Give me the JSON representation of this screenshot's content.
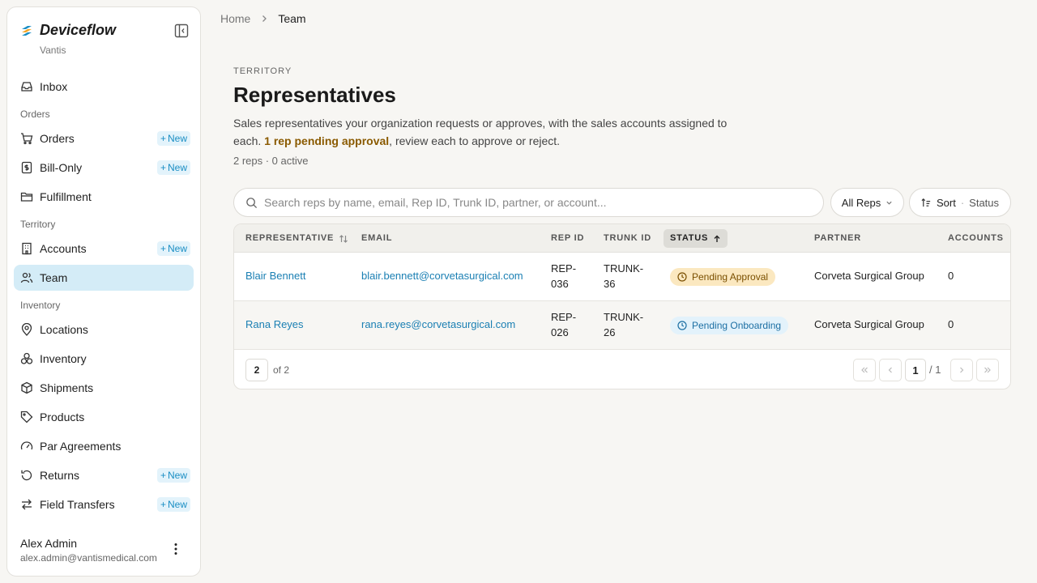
{
  "sidebar": {
    "brand": "Deviceflow",
    "org": "Vantis",
    "inbox": "Inbox",
    "sections": {
      "orders": "Orders",
      "territory": "Territory",
      "inventory": "Inventory"
    },
    "items": {
      "orders": "Orders",
      "bill_only": "Bill-Only",
      "fulfillment": "Fulfillment",
      "accounts": "Accounts",
      "team": "Team",
      "locations": "Locations",
      "inventory": "Inventory",
      "shipments": "Shipments",
      "products": "Products",
      "par_agreements": "Par Agreements",
      "returns": "Returns",
      "field_transfers": "Field Transfers"
    },
    "new_label": "New",
    "user": {
      "name": "Alex Admin",
      "email": "alex.admin@vantismedical.com"
    }
  },
  "breadcrumb": {
    "home": "Home",
    "current": "Team"
  },
  "page": {
    "eyebrow": "TERRITORY",
    "title": "Representatives",
    "desc_pre": "Sales representatives your organization requests or approves, with the sales accounts assigned to each. ",
    "desc_highlight": "1 rep pending approval",
    "desc_post": ", review each to approve or reject.",
    "counts": "2 reps · 0 active"
  },
  "toolbar": {
    "search_placeholder": "Search reps by name, email, Rep ID, Trunk ID, partner, or account...",
    "filter": "All Reps",
    "sort_label": "Sort",
    "sort_sep": "·",
    "sort_value": "Status"
  },
  "table": {
    "headers": {
      "representative": "REPRESENTATIVE",
      "email": "EMAIL",
      "rep_id": "REP ID",
      "trunk_id": "TRUNK ID",
      "status": "STATUS",
      "partner": "PARTNER",
      "accounts": "ACCOUNTS"
    },
    "rows": [
      {
        "name": "Blair Bennett",
        "email": "blair.bennett@corvetasurgical.com",
        "rep_id_1": "REP-",
        "rep_id_2": "036",
        "trunk_id_1": "TRUNK-",
        "trunk_id_2": "36",
        "status": "Pending Approval",
        "partner": "Corveta Surgical Group",
        "accounts": "0"
      },
      {
        "name": "Rana Reyes",
        "email": "rana.reyes@corvetasurgical.com",
        "rep_id_1": "REP-",
        "rep_id_2": "026",
        "trunk_id_1": "TRUNK-",
        "trunk_id_2": "26",
        "status": "Pending Onboarding",
        "partner": "Corveta Surgical Group",
        "accounts": "0"
      }
    ],
    "footer": {
      "page_size": "2",
      "of_text": "of 2",
      "current_page": "1",
      "page_total": "/  1"
    }
  },
  "colors": {
    "accent": "#1a7fb3",
    "active_nav": "#d4ecf7",
    "pending_approval_bg": "#fbe8c0",
    "pending_onboarding_bg": "#e3f2fb"
  }
}
